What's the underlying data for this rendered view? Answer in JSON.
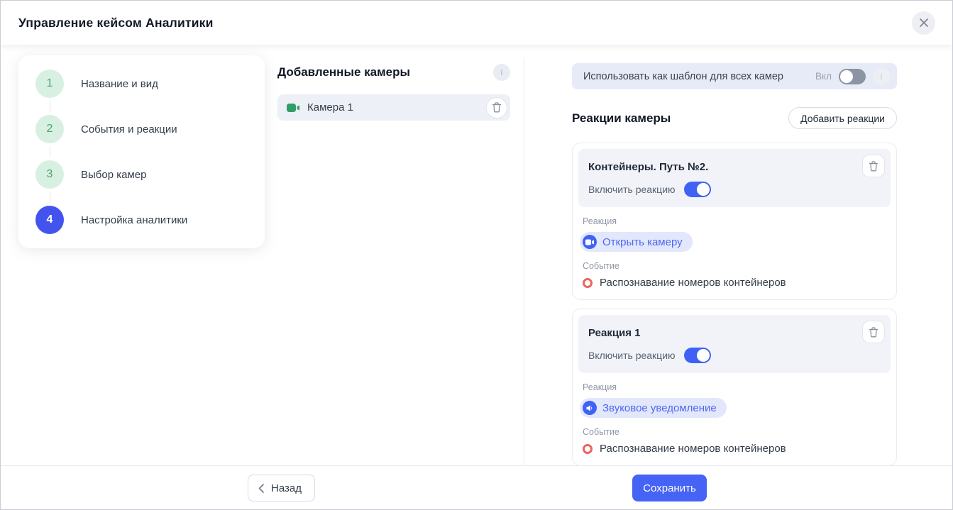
{
  "header": {
    "title": "Управление кейсом Аналитики"
  },
  "stepper": {
    "active_step": 4,
    "steps": [
      {
        "number": "1",
        "label": "Название и вид"
      },
      {
        "number": "2",
        "label": "События и реакции"
      },
      {
        "number": "3",
        "label": "Выбор камер"
      },
      {
        "number": "4",
        "label": "Настройка аналитики"
      }
    ]
  },
  "cameras": {
    "title": "Добавленные камеры",
    "info_icon": "info-icon",
    "items": [
      {
        "name": "Камера 1",
        "icon": "video-camera-icon"
      }
    ]
  },
  "template_toggle": {
    "label": "Использовать как шаблон для всех камер",
    "state_label": "Вкл",
    "enabled": false,
    "info_icon": "info-icon"
  },
  "reactions": {
    "title": "Реакции камеры",
    "add_button_label": "Добавить реакции",
    "cards": [
      {
        "title": "Контейнеры. Путь №2.",
        "toggle_label": "Включить реакцию",
        "enabled": true,
        "reaction_label": "Реакция",
        "reaction_value": "Открыть камеру",
        "reaction_icon": "video-camera-icon",
        "event_label": "Событие",
        "event_value": "Распознавание номеров контейнеров",
        "event_icon": "red-ring-icon"
      },
      {
        "title": "Реакция 1",
        "toggle_label": "Включить реакцию",
        "enabled": true,
        "reaction_label": "Реакция",
        "reaction_value": "Звуковое уведомление",
        "reaction_icon": "speaker-icon",
        "event_label": "Событие",
        "event_value": "Распознавание номеров контейнеров",
        "event_icon": "red-ring-icon"
      }
    ]
  },
  "footer": {
    "back_label": "Назад",
    "save_label": "Сохранить"
  },
  "colors": {
    "primary_blue": "#4563f5",
    "step_active_bg": "#4354ee",
    "step_inactive_bg": "#d8f0e2",
    "step_inactive_text": "#4d9f79",
    "camera_icon_green": "#2f9e68",
    "event_ring_red": "#ec655c",
    "chip_bg": "#e2e7fc",
    "chip_text": "#4f68ef",
    "template_row_bg": "#e7ebf8",
    "card_head_bg": "#f1f3f9"
  }
}
